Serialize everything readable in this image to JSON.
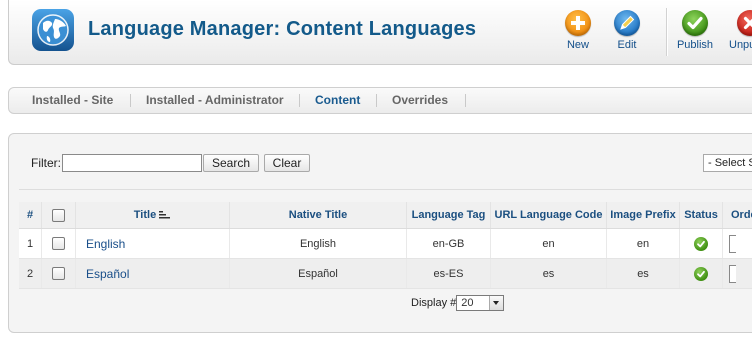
{
  "header": {
    "title": "Language Manager: Content Languages",
    "toolbar": [
      {
        "label": "New",
        "icon": "plus-icon",
        "color": "#f39a1b"
      },
      {
        "label": "Edit",
        "icon": "pencil-icon",
        "color": "#2f8cd6"
      },
      {
        "label": "Publish",
        "icon": "checkmark-icon",
        "color": "#5aa829"
      },
      {
        "label": "Unpublish",
        "icon": "x-icon",
        "color": "#d3261f"
      }
    ]
  },
  "submenu": {
    "tabs": [
      {
        "label": "Installed - Site"
      },
      {
        "label": "Installed - Administrator"
      },
      {
        "label": "Content",
        "active": true
      },
      {
        "label": "Overrides"
      }
    ]
  },
  "filter": {
    "label": "Filter:",
    "value": "",
    "search_label": "Search",
    "clear_label": "Clear",
    "status_select": "- Select Status -"
  },
  "table": {
    "columns": [
      "#",
      "",
      "Title",
      "Native Title",
      "Language Tag",
      "URL Language Code",
      "Image Prefix",
      "Status",
      "Ordering"
    ],
    "rows": [
      {
        "num": "1",
        "title": "English",
        "native_title": "English",
        "tag": "en-GB",
        "url_code": "en",
        "image_prefix": "en",
        "status": "published"
      },
      {
        "num": "2",
        "title": "Español",
        "native_title": "Español",
        "tag": "es-ES",
        "url_code": "es",
        "image_prefix": "es",
        "status": "published"
      }
    ],
    "display_label": "Display #",
    "display_value": "20"
  }
}
